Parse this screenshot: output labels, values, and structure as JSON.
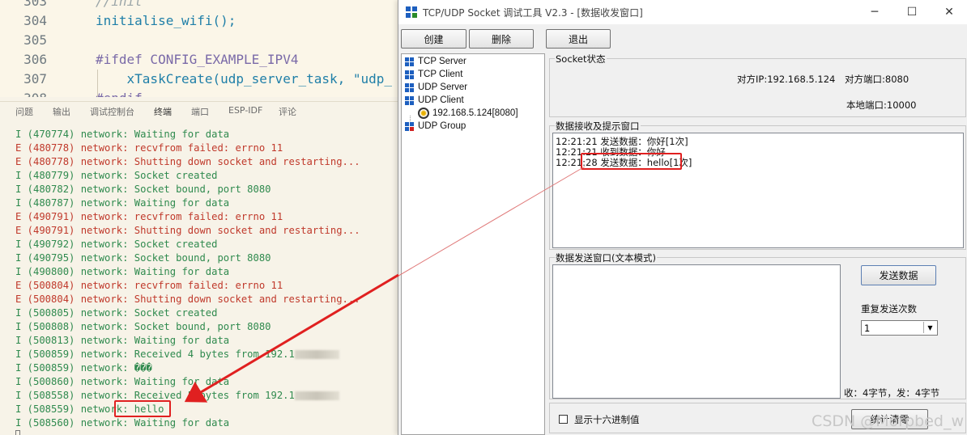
{
  "editor": {
    "lines": [
      {
        "num": "303",
        "code": "//init"
      },
      {
        "num": "304",
        "code": "initialise_wifi();"
      },
      {
        "num": "305",
        "code": ""
      },
      {
        "num": "306",
        "code": "#ifdef CONFIG_EXAMPLE_IPV4"
      },
      {
        "num": "307",
        "code": "    xTaskCreate(udp_server_task, \"udp_"
      },
      {
        "num": "308",
        "code": "#endif"
      }
    ]
  },
  "panel_tabs": [
    "问题",
    "输出",
    "调试控制台",
    "终端",
    "端口",
    "ESP-IDF",
    "评论"
  ],
  "panel_active_tab": "终端",
  "terminal": {
    "lines": [
      {
        "level": "I",
        "text": "I (470774) network: Waiting for data"
      },
      {
        "level": "E",
        "text": "E (480778) network: recvfrom failed: errno 11"
      },
      {
        "level": "E",
        "text": "E (480778) network: Shutting down socket and restarting..."
      },
      {
        "level": "I",
        "text": "I (480779) network: Socket created"
      },
      {
        "level": "I",
        "text": "I (480782) network: Socket bound, port 8080"
      },
      {
        "level": "I",
        "text": "I (480787) network: Waiting for data"
      },
      {
        "level": "E",
        "text": "E (490791) network: recvfrom failed: errno 11"
      },
      {
        "level": "E",
        "text": "E (490791) network: Shutting down socket and restarting..."
      },
      {
        "level": "I",
        "text": "I (490792) network: Socket created"
      },
      {
        "level": "I",
        "text": "I (490795) network: Socket bound, port 8080"
      },
      {
        "level": "I",
        "text": "I (490800) network: Waiting for data"
      },
      {
        "level": "E",
        "text": "E (500804) network: recvfrom failed: errno 11"
      },
      {
        "level": "E",
        "text": "E (500804) network: Shutting down socket and restarting..."
      },
      {
        "level": "I",
        "text": "I (500805) network: Socket created"
      },
      {
        "level": "I",
        "text": "I (500808) network: Socket bound, port 8080"
      },
      {
        "level": "I",
        "text": "I (500813) network: Waiting for data"
      },
      {
        "level": "I",
        "text": "I (500859) network: Received 4 bytes from 192.1"
      },
      {
        "level": "I",
        "text": "I (500859) network: ���"
      },
      {
        "level": "I",
        "text": "I (500860) network: Waiting for data"
      },
      {
        "level": "I",
        "text": "I (508558) network: Received 5 bytes from 192.1"
      },
      {
        "level": "I",
        "text": "I (508559) network: hello"
      },
      {
        "level": "I",
        "text": "I (508560) network: Waiting for data"
      }
    ]
  },
  "tool": {
    "title": "TCP/UDP Socket 调试工具 V2.3 - [数据收发窗口]",
    "buttons": {
      "create": "创建",
      "delete": "删除",
      "exit": "退出"
    },
    "tree": {
      "items": [
        "TCP Server",
        "TCP Client",
        "UDP Server",
        "UDP Client"
      ],
      "child": "192.168.5.124[8080]",
      "last": "UDP Group"
    },
    "socket_state": {
      "label": "Socket状态",
      "remote_ip": "对方IP:192.168.5.124",
      "remote_port": "对方端口:8080",
      "local_port": "本地端口:10000"
    },
    "receive": {
      "label": "数据接收及提示窗口",
      "lines": [
        "12:21:21 发送数据：你好[1次]",
        "12:21:21 收到数据：你好",
        "12:21:28 发送数据：hello[1次]"
      ]
    },
    "send": {
      "label": "数据发送窗口(文本模式)",
      "send_button": "发送数据",
      "repeat_label": "重复发送次数",
      "repeat_value": "1",
      "status": "收：4字节，发：4字节"
    },
    "hex_label": "显示十六进制值",
    "clear_button": "统计清零"
  },
  "watermark": "CSDN @Morpbed_w",
  "colors": {
    "highlight": "#e02020",
    "info": "#2f8a4e",
    "error": "#c0392b"
  }
}
